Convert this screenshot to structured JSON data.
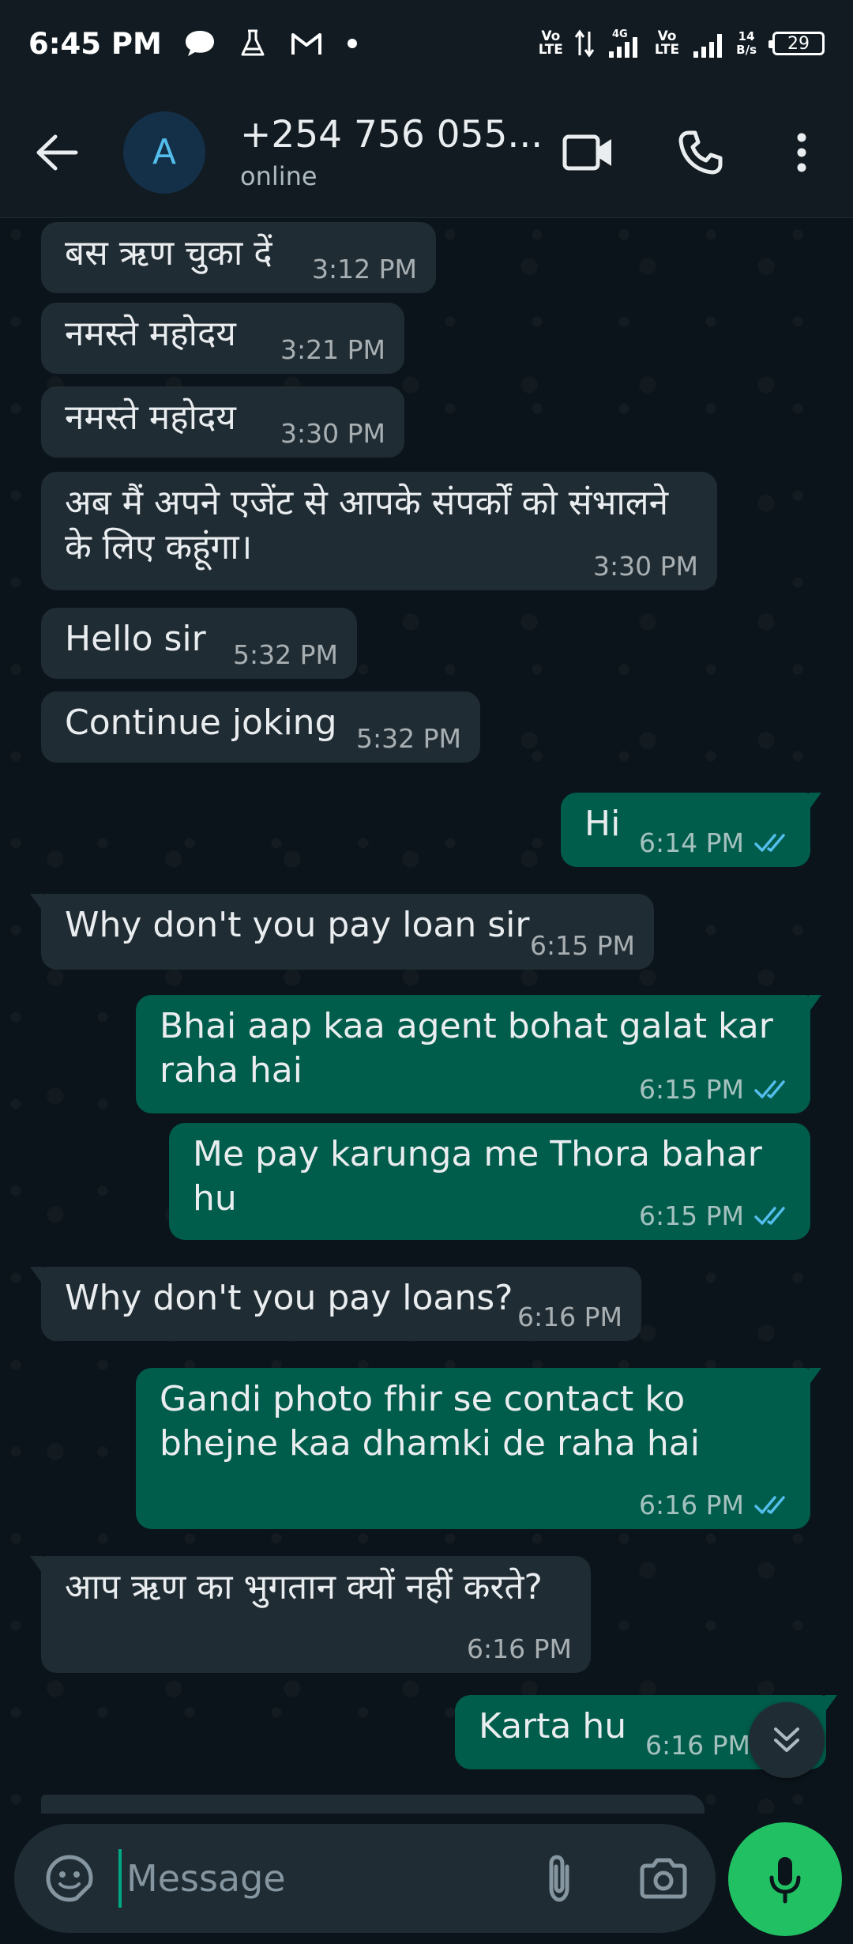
{
  "status_bar": {
    "time": "6:45 PM",
    "volte1": "Vo\nLTE",
    "net_type": "4G",
    "volte2": "Vo\nLTE",
    "speed_value": "14",
    "speed_unit": "B/s",
    "battery": "29"
  },
  "header": {
    "avatar_letter": "A",
    "contact_name": "+254 756 055...",
    "status": "online"
  },
  "messages": [
    {
      "dir": "in",
      "text": "बस ऋण चुका दें",
      "time": "3:12 PM"
    },
    {
      "dir": "in",
      "text": "नमस्ते महोदय",
      "time": "3:21 PM"
    },
    {
      "dir": "in",
      "text": "नमस्ते महोदय",
      "time": "3:30 PM"
    },
    {
      "dir": "in",
      "text": "अब मैं अपने एजेंट से आपके संपर्कों को संभालने के लिए कहूंगा।",
      "time": "3:30 PM"
    },
    {
      "dir": "in",
      "text": "Hello sir",
      "time": "5:32 PM"
    },
    {
      "dir": "in",
      "text": "Continue joking",
      "time": "5:32 PM"
    },
    {
      "dir": "out",
      "text": "Hi",
      "time": "6:14 PM"
    },
    {
      "dir": "in",
      "text": "Why don't you pay loan sir",
      "time": "6:15 PM"
    },
    {
      "dir": "out",
      "text": "Bhai aap kaa agent bohat galat kar raha hai",
      "time": "6:15 PM"
    },
    {
      "dir": "out",
      "text": "Me pay karunga me Thora bahar hu",
      "time": "6:15 PM"
    },
    {
      "dir": "in",
      "text": "Why don't you pay loans?",
      "time": "6:16 PM"
    },
    {
      "dir": "out",
      "text": "Gandi photo fhir se contact ko bhejne kaa dhamki de raha hai",
      "time": "6:16 PM"
    },
    {
      "dir": "in",
      "text": "आप ऋण का भुगतान क्यों नहीं करते?",
      "time": "6:16 PM"
    },
    {
      "dir": "out",
      "text": "Karta hu",
      "time": "6:16 PM"
    }
  ],
  "composer": {
    "placeholder": "Message"
  },
  "colors": {
    "background": "#0b141a",
    "incoming_bubble": "#202c33",
    "outgoing_bubble": "#005c4b",
    "read_ticks": "#53bdeb",
    "mic_button": "#21c063"
  }
}
